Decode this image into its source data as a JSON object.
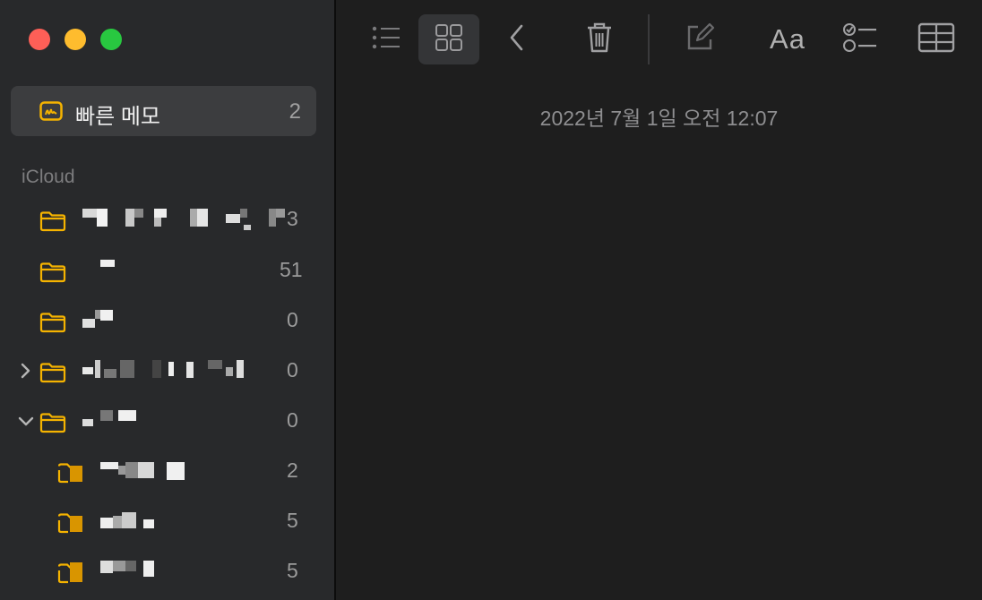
{
  "window": {
    "controls": [
      "close",
      "minimize",
      "zoom"
    ],
    "colors": {
      "close": "#fe5f57",
      "minimize": "#febc2e",
      "zoom": "#28c840"
    }
  },
  "sidebar": {
    "quick_notes": {
      "label": "빠른 메모",
      "count": "2",
      "icon": "quick-note-icon"
    },
    "section_label": "iCloud",
    "folders": [
      {
        "count": "3",
        "icon": "folder-icon",
        "expander": null,
        "level": 0
      },
      {
        "count": "51",
        "icon": "folder-icon",
        "expander": null,
        "level": 0
      },
      {
        "count": "0",
        "icon": "folder-icon",
        "expander": null,
        "level": 0
      },
      {
        "count": "0",
        "icon": "folder-icon",
        "expander": "collapsed",
        "level": 0
      },
      {
        "count": "0",
        "icon": "folder-icon",
        "expander": "expanded",
        "level": 0
      },
      {
        "count": "2",
        "icon": "shared-folder-icon",
        "expander": null,
        "level": 1
      },
      {
        "count": "5",
        "icon": "shared-folder-icon",
        "expander": null,
        "level": 1
      },
      {
        "count": "5",
        "icon": "shared-folder-icon",
        "expander": null,
        "level": 1
      }
    ]
  },
  "toolbar": {
    "buttons": [
      "list-view-icon",
      "gallery-view-icon",
      "back-icon",
      "trash-icon",
      "compose-icon",
      "format-icon",
      "checklist-icon",
      "table-icon"
    ],
    "format_label": "Aa",
    "active": "gallery-view-icon"
  },
  "note": {
    "date": "2022년 7월 1일 오전 12:07"
  },
  "colors": {
    "accent": "#f5b300",
    "sidebar_bg": "#28292b",
    "content_bg": "#1e1e1e"
  }
}
